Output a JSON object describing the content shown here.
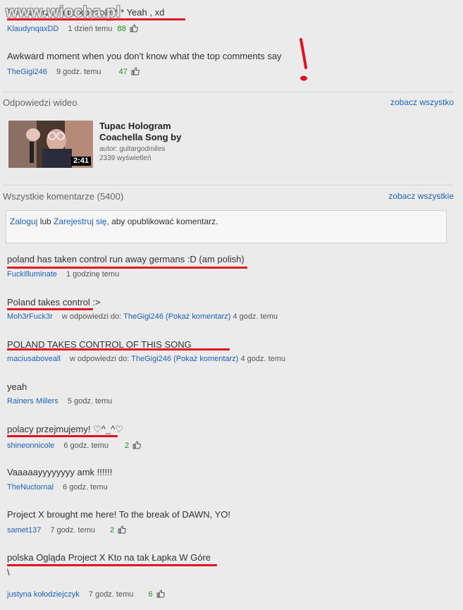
{
  "watermark": "www.wiocha.pl",
  "top_comments": [
    {
      "text": "Polska przejmuje kontrole * * Yeah , xd",
      "user": "KlaudynqaxDD",
      "time": "1 dzień temu",
      "votes": "88"
    },
    {
      "text": "Awkward moment when you don't know what the top comments say",
      "user": "TheGigi246",
      "time": "9 godz. temu",
      "votes": "47"
    }
  ],
  "annotation_mark": "!",
  "video_responses": {
    "title": "Odpowiedzi wideo",
    "see_all": "zobacz wszystko",
    "video": {
      "title_line1": "Tupac Hologram",
      "title_line2": "Coachella Song by",
      "author": "autor: guitargodmiles",
      "views": "2339 wyświetleń",
      "duration": "2:41"
    }
  },
  "all_comments": {
    "title": "Wszystkie komentarze (5400)",
    "see_all": "zobacz wszystkie",
    "login_link": "Zaloguj",
    "login_or": " lub ",
    "register_link": "Zarejestruj się",
    "login_suffix": ", aby opublikować komentarz."
  },
  "comments": [
    {
      "text": "poland has taken control run away germans :D (am polish)",
      "user": "FuckIlluminate",
      "time": "1 godzinę temu"
    },
    {
      "text": "Poland takes control :>",
      "user": "Moh3rFuck3r",
      "reply_prefix": "w odpowiedzi do: ",
      "reply_to": "TheGigi246 (Pokaż komentarz)",
      "time": "4 godz. temu"
    },
    {
      "text": "POLAND TAKES CONTROL OF THIS SONG",
      "user": "maciusaboveall",
      "reply_prefix": "w odpowiedzi do: ",
      "reply_to": "TheGigi246 (Pokaż komentarz)",
      "time": "4 godz. temu"
    },
    {
      "text": "yeah",
      "user": "Rainers Millers",
      "time": "5 godz. temu"
    },
    {
      "text": "polacy przejmujemy! ♡^_^♡",
      "user": "shineonnicole",
      "time": "6 godz. temu",
      "votes": "2"
    },
    {
      "text": "Vaaaaayyyyyyyy amk !!!!!!",
      "user": "TheNuctornal",
      "time": "6 godz. temu"
    },
    {
      "text": "Project X brought me here! To the break of DAWN, YO!",
      "user": "samet137",
      "time": "7 godz. temu",
      "votes": "2"
    },
    {
      "text": "polska Ogląda Project X Kto na tak Łapka W Góre",
      "text_line2": "\\",
      "user": "justyna kołodziejczyk",
      "time": "7 godz. temu",
      "votes": "6"
    }
  ],
  "colors": {
    "link": "#1c62b9",
    "votes": "#1c8f1c",
    "annotation": "#e01020",
    "background": "#ebebeb"
  }
}
